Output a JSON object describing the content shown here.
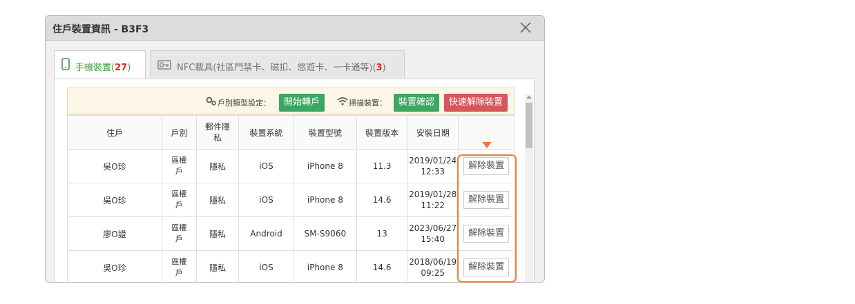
{
  "dialog": {
    "title": "住戶裝置資訊 - B3F3"
  },
  "tabs": [
    {
      "label": "手機裝置",
      "count": "27",
      "active": true,
      "icon": "phone-icon"
    },
    {
      "label": "NFC載具(社區門禁卡、磁扣、悠遊卡、一卡通等)",
      "count": "3",
      "active": false,
      "icon": "nfc-card-icon"
    }
  ],
  "toolbar": {
    "type_setting_label": "戶別類型設定：",
    "start_transfer_button": "開始轉戶",
    "scan_label": "掃描裝置：",
    "confirm_button": "裝置確認",
    "quick_remove_button": "快速解除裝置"
  },
  "table": {
    "headers": [
      "住戶",
      "戶別",
      "郵件隱私",
      "裝置系統",
      "裝置型號",
      "裝置版本",
      "安裝日期",
      ""
    ],
    "rows": [
      {
        "resident": "吳O珍",
        "unit_type": "區權戶",
        "privacy": "隱私",
        "os": "iOS",
        "model": "iPhone 8",
        "version": "11.3",
        "date": "2019/01/24",
        "time": "12:33",
        "action": "解除裝置"
      },
      {
        "resident": "吳O珍",
        "unit_type": "區權戶",
        "privacy": "隱私",
        "os": "iOS",
        "model": "iPhone 8",
        "version": "14.6",
        "date": "2019/01/28",
        "time": "11:22",
        "action": "解除裝置"
      },
      {
        "resident": "廖O證",
        "unit_type": "區權戶",
        "privacy": "隱私",
        "os": "Android",
        "model": "SM-S9060",
        "version": "13",
        "date": "2023/06/27",
        "time": "15:40",
        "action": "解除裝置"
      },
      {
        "resident": "吳O珍",
        "unit_type": "區權戶",
        "privacy": "隱私",
        "os": "iOS",
        "model": "iPhone 8",
        "version": "14.6",
        "date": "2018/06/19",
        "time": "09:25",
        "action": "解除裝置"
      }
    ]
  },
  "colors": {
    "accent_green": "#3ba760",
    "danger_red": "#d9555c",
    "highlight_orange": "#ee7a3b",
    "count_red": "#e52323"
  }
}
